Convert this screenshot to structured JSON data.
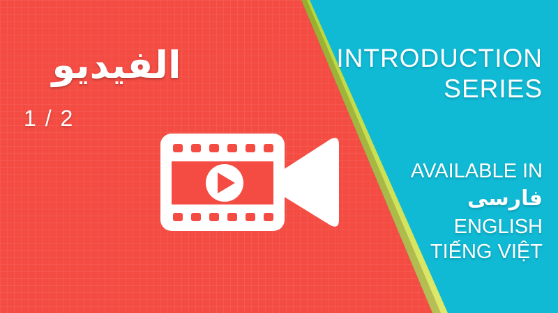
{
  "title_arabic": "الفیدیو",
  "part_indicator": "1 / 2",
  "series_line1": "INTRODUCTION",
  "series_line2": "SERIES",
  "available_label": "AVAILABLE IN",
  "languages": [
    "فارسی",
    "ENGLISH",
    "TIẾNG VIỆT"
  ],
  "colors": {
    "red_panel": "#f44c43",
    "cyan_panel": "#10b9d4",
    "accent_stripe": "#c8e04a",
    "text": "#ffffff"
  },
  "icons": [
    "video-camera-icon",
    "play-icon"
  ]
}
